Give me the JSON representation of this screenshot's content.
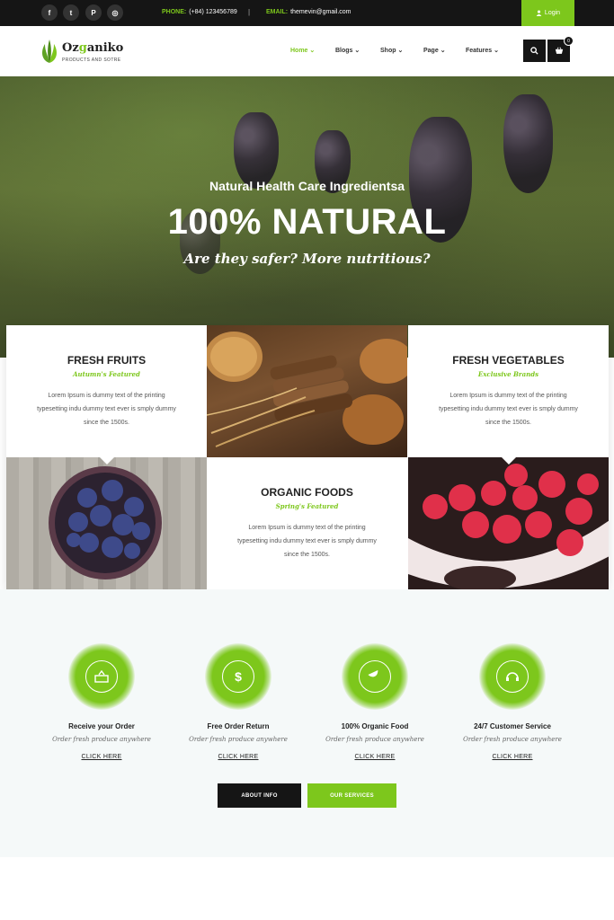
{
  "topbar": {
    "social": [
      {
        "icon": "facebook-icon",
        "glyph": "f"
      },
      {
        "icon": "twitter-icon",
        "glyph": "t"
      },
      {
        "icon": "pinterest-icon",
        "glyph": "P"
      },
      {
        "icon": "dribbble-icon",
        "glyph": "◎"
      }
    ],
    "phone_label": "PHONE:",
    "phone": "(+84) 123456789",
    "separator": "|",
    "email_label": "EMAIL:",
    "email": "themevin@gmail.com",
    "login": "Login"
  },
  "header": {
    "logo_name_prefix": "Oz",
    "logo_name_accent": "g",
    "logo_name_suffix": "aniko",
    "logo_tagline": "PRODUCTS AND SOTRE",
    "nav": [
      "Home",
      "Blogs",
      "Shop",
      "Page",
      "Features"
    ],
    "cart_count": "0"
  },
  "hero": {
    "subtitle": "Natural Health Care Ingredientsa",
    "title": "100% NATURAL",
    "tagline": "Are they safer? More nutritious?"
  },
  "features": [
    {
      "title": "FRESH FRUITS",
      "subtitle": "Autumn's Featured",
      "description": "Lorem Ipsum is dummy text of the printing typesetting indu dummy text ever is smply dummy since the 1500s."
    },
    {
      "title": "FRESH VEGETABLES",
      "subtitle": "Exclusive Brands",
      "description": "Lorem Ipsum is dummy text of the printing typesetting indu dummy text ever is smply dummy since the 1500s."
    },
    {
      "title": "ORGANIC FOODS",
      "subtitle": "Spring's Featured",
      "description": "Lorem Ipsum is dummy text of the printing typesetting indu dummy text ever is smply dummy since the 1500s."
    }
  ],
  "services": [
    {
      "title": "Receive your Order",
      "subtitle": "Order fresh produce anywhere",
      "link": "CLICK HERE",
      "icon": "box-icon"
    },
    {
      "title": "Free Order Return",
      "subtitle": "Order fresh produce anywhere",
      "link": "CLICK HERE",
      "icon": "dollar-cycle-icon"
    },
    {
      "title": "100% Organic Food",
      "subtitle": "Order fresh produce anywhere",
      "link": "CLICK HERE",
      "icon": "melon-slice-icon"
    },
    {
      "title": "24/7 Customer Service",
      "subtitle": "Order fresh produce anywhere",
      "link": "CLICK HERE",
      "icon": "headset-icon"
    }
  ],
  "buttons": {
    "about": "ABOUT INFO",
    "services": "OUR SERVICES"
  },
  "colors": {
    "accent": "#7dc71c",
    "dark": "#151515"
  }
}
